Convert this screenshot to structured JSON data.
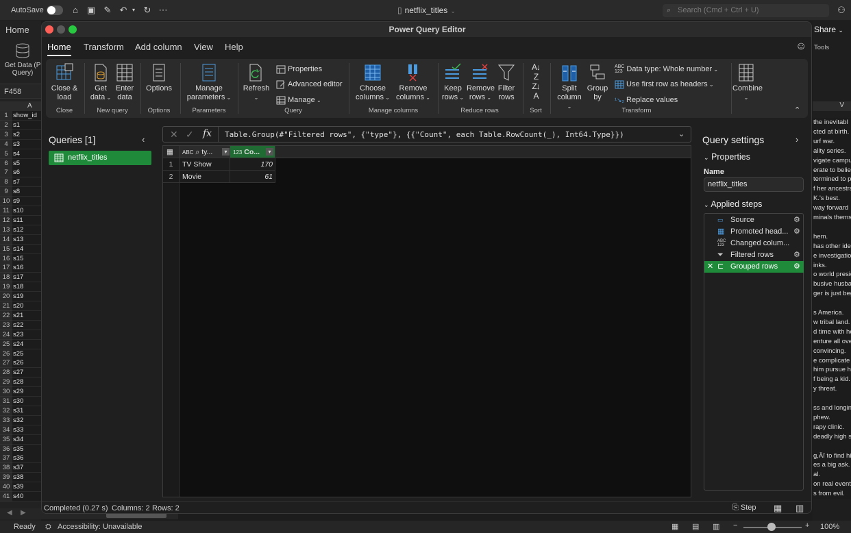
{
  "excel": {
    "autosave_label": "AutoSave",
    "doc_title": "netflix_titles",
    "search_placeholder": "Search (Cmd + Ctrl + U)",
    "home_tab": "Home",
    "get_data_label": "Get Data (P Query)",
    "cell_ref": "F458",
    "col_a": "A",
    "col_v": "V",
    "share_label": "Share",
    "tools_label": "Tools",
    "rows": [
      {
        "n": "1",
        "v": "show_id"
      },
      {
        "n": "2",
        "v": "s1"
      },
      {
        "n": "3",
        "v": "s2"
      },
      {
        "n": "4",
        "v": "s3"
      },
      {
        "n": "5",
        "v": "s4"
      },
      {
        "n": "6",
        "v": "s5"
      },
      {
        "n": "7",
        "v": "s6"
      },
      {
        "n": "8",
        "v": "s7"
      },
      {
        "n": "9",
        "v": "s8"
      },
      {
        "n": "10",
        "v": "s9"
      },
      {
        "n": "11",
        "v": "s10"
      },
      {
        "n": "12",
        "v": "s11"
      },
      {
        "n": "13",
        "v": "s12"
      },
      {
        "n": "14",
        "v": "s13"
      },
      {
        "n": "15",
        "v": "s14"
      },
      {
        "n": "16",
        "v": "s15"
      },
      {
        "n": "17",
        "v": "s16"
      },
      {
        "n": "18",
        "v": "s17"
      },
      {
        "n": "19",
        "v": "s18"
      },
      {
        "n": "20",
        "v": "s19"
      },
      {
        "n": "21",
        "v": "s20"
      },
      {
        "n": "22",
        "v": "s21"
      },
      {
        "n": "23",
        "v": "s22"
      },
      {
        "n": "24",
        "v": "s23"
      },
      {
        "n": "25",
        "v": "s24"
      },
      {
        "n": "26",
        "v": "s25"
      },
      {
        "n": "27",
        "v": "s26"
      },
      {
        "n": "28",
        "v": "s27"
      },
      {
        "n": "29",
        "v": "s28"
      },
      {
        "n": "30",
        "v": "s29"
      },
      {
        "n": "31",
        "v": "s30"
      },
      {
        "n": "32",
        "v": "s31"
      },
      {
        "n": "33",
        "v": "s32"
      },
      {
        "n": "34",
        "v": "s33"
      },
      {
        "n": "35",
        "v": "s34"
      },
      {
        "n": "36",
        "v": "s35"
      },
      {
        "n": "37",
        "v": "s36"
      },
      {
        "n": "38",
        "v": "s37"
      },
      {
        "n": "39",
        "v": "s38"
      },
      {
        "n": "40",
        "v": "s39"
      },
      {
        "n": "41",
        "v": "s40"
      }
    ],
    "right_texts": [
      "the inevitabl",
      "cted at birth.",
      "urf war.",
      "ality series.",
      "vigate campus",
      "erate to belie",
      "termined to p",
      "f her ancestra",
      "K.'s best.",
      "way forward",
      "minals thems",
      "",
      "hem.",
      "has other idea",
      "e investigatio",
      "inks.",
      "o world presid",
      "busive husba",
      "ger is just beg",
      "",
      "s America.",
      "w tribal land.",
      "d time with he",
      "enture all over",
      " convincing.",
      "e complicate",
      "him pursue he",
      "f being a kid.",
      "y threat.",
      "",
      "ss and longing",
      "phew.",
      "rapy clinic.",
      "deadly high s",
      "",
      "g,Äî to find hi",
      "es a big ask.",
      "al.",
      "on real events",
      "s from evil."
    ],
    "status_ready": "Ready",
    "status_accessibility": "Accessibility: Unavailable",
    "zoom": "100%"
  },
  "pq": {
    "window_title": "Power Query Editor",
    "tabs": [
      "Home",
      "Transform",
      "Add column",
      "View",
      "Help"
    ],
    "ribbon": {
      "close_load": "Close & load",
      "get_data": "Get data",
      "enter_data": "Enter data",
      "options": "Options",
      "manage_parameters": "Manage parameters",
      "refresh": "Refresh",
      "properties": "Properties",
      "advanced_editor": "Advanced editor",
      "manage": "Manage",
      "choose_columns": "Choose columns",
      "remove_columns": "Remove columns",
      "keep_rows": "Keep rows",
      "remove_rows": "Remove rows",
      "filter_rows": "Filter rows",
      "split_column": "Split column",
      "group_by": "Group by",
      "data_type": "Data type: Whole number",
      "use_first_row": "Use first row as headers",
      "replace_values": "Replace values",
      "combine": "Combine",
      "groups": {
        "close": "Close",
        "new_query": "New query",
        "options": "Options",
        "parameters": "Parameters",
        "query": "Query",
        "manage_columns": "Manage columns",
        "reduce_rows": "Reduce rows",
        "sort": "Sort",
        "transform": "Transform"
      }
    },
    "queries_title": "Queries [1]",
    "query_name": "netflix_titles",
    "formula": "Table.Group(#\"Filtered rows\", {\"type\"}, {{\"Count\", each Table.RowCount(_), Int64.Type}})",
    "columns": [
      {
        "type_icon": "ABC",
        "name": "ty..."
      },
      {
        "type_icon": "123",
        "name": "Co..."
      }
    ],
    "rows": [
      {
        "idx": "1",
        "type": "TV Show",
        "count": "170"
      },
      {
        "idx": "2",
        "type": "Movie",
        "count": "61"
      }
    ],
    "settings": {
      "title": "Query settings",
      "properties": "Properties",
      "name_label": "Name",
      "name_value": "netflix_titles",
      "applied_steps": "Applied steps",
      "steps": [
        "Source",
        "Promoted head...",
        "Changed colum...",
        "Filtered rows",
        "Grouped rows"
      ]
    },
    "status": {
      "completed": "Completed (0.27 s)",
      "columns": "Columns: 2",
      "rows": "Rows: 2",
      "step": "Step"
    },
    "accent_color": "#1f8a3a"
  }
}
